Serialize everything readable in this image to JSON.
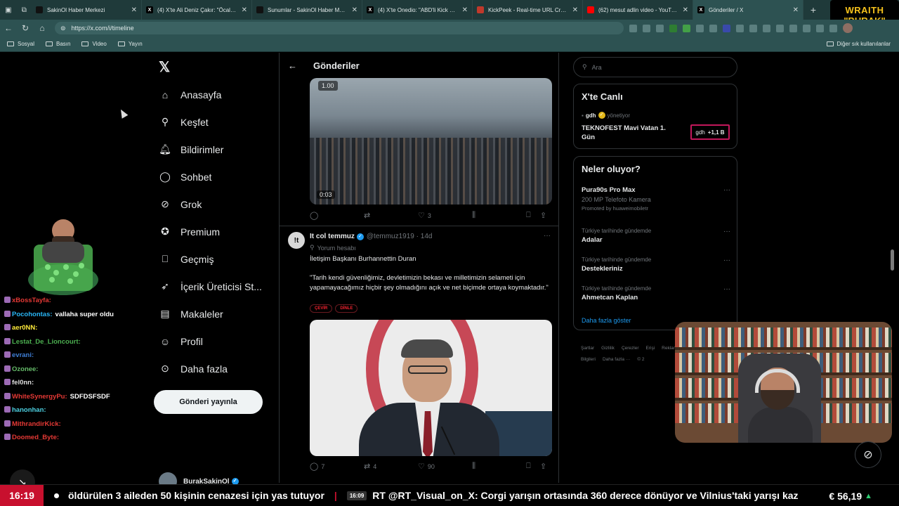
{
  "browser": {
    "tabs": [
      {
        "title": "SakinOl Haber Merkezi",
        "icon": "tiktok-icon",
        "color": "#111111"
      },
      {
        "title": "(4) X'te Ali Deniz Çakır: \"Öcalan, G",
        "icon": "x-icon",
        "color": "#000000"
      },
      {
        "title": "Sunumlar - SakinOl Haber Merkezi",
        "icon": "tiktok-icon",
        "color": "#111111"
      },
      {
        "title": "(4) X'te Onedio: \"ABD'li Kick yayı",
        "icon": "x-icon",
        "color": "#000000"
      },
      {
        "title": "KickPeek - Real-time URL Crawler",
        "icon": "kickpeek-icon",
        "color": "#c0392b"
      },
      {
        "title": "(62) mesut adlin video - YouTube",
        "icon": "youtube-icon",
        "color": "#ff0000"
      },
      {
        "title": "Gönderiler / X",
        "icon": "x-icon",
        "color": "#000000"
      }
    ],
    "url": "https://x.com/i/timeline",
    "bookmarks": [
      "Sosyal",
      "Basın",
      "Video",
      "Yayın"
    ],
    "bookmarks_right": "Diğer sık kullanılanlar"
  },
  "stream_logo": {
    "line1": "WRAITH",
    "line2": "\"BURAK\""
  },
  "nav": {
    "items": [
      {
        "label": "Anasayfa",
        "icon": "home-icon"
      },
      {
        "label": "Keşfet",
        "icon": "search-icon"
      },
      {
        "label": "Bildirimler",
        "icon": "bell-icon"
      },
      {
        "label": "Sohbet",
        "icon": "chat-icon"
      },
      {
        "label": "Grok",
        "icon": "grok-icon"
      },
      {
        "label": "Premium",
        "icon": "premium-icon"
      },
      {
        "label": "Geçmiş",
        "icon": "bookmark-icon"
      },
      {
        "label": "İçerik Üreticisi St...",
        "icon": "rocket-icon"
      },
      {
        "label": "Makaleler",
        "icon": "article-icon"
      },
      {
        "label": "Profil",
        "icon": "person-icon"
      },
      {
        "label": "Daha fazla",
        "icon": "more-icon"
      }
    ],
    "post_button": "Gönderi yayınla",
    "profile_name": "BurakSakinOl"
  },
  "timeline": {
    "title": "Gönderiler",
    "tweet1": {
      "video_speed": "1.00",
      "video_duration": "0:03",
      "likes": "3"
    },
    "tweet2": {
      "avatar_text": "!t",
      "name": "It col temmuz",
      "handle": "@temmuz1919 · 14d",
      "sub": "Yorum hesabı",
      "text": "İletişim Başkanı Burhannettin  Duran\n\n \"Tarih kendi güvenliğimiz, devletimizin bekası ve milletimizin selameti için yapamayacağımız hiçbir şey olmadığını açık ve net biçimde ortaya koymaktadır.\"",
      "chip1": "ÇEVİR",
      "chip2": "DİNLE",
      "replies": "7",
      "reposts": "4",
      "likes": "90"
    }
  },
  "sidebar": {
    "search_placeholder": "Ara",
    "live": {
      "title": "X'te Canlı",
      "host": "gdh",
      "host_suffix": "yönetiyor",
      "event": "TEKNOFEST Mavi Vatan 1. Gün",
      "count_host": "gdh",
      "count": "+1,1 B"
    },
    "trends": {
      "title": "Neler oluyor?",
      "items": [
        {
          "meta": "",
          "title": "Pura90s Pro Max",
          "sub": "200 MP Telefoto Kamera",
          "promo": "Promoted by huaweimobiletr"
        },
        {
          "meta": "Türkiye tarihinde gündemde",
          "title": "Adalar"
        },
        {
          "meta": "Türkiye tarihinde gündemde",
          "title": "Destekleriniz"
        },
        {
          "meta": "Türkiye tarihinde gündemde",
          "title": "Ahmetcan Kaplan"
        }
      ],
      "show_more": "Daha fazla göster"
    },
    "footer": [
      "Şartlar",
      "Gizlilik",
      "Çerezler",
      "Erişi",
      "Reklam Bilgileri",
      "Daha fazla ···",
      "© 2"
    ]
  },
  "chat": [
    {
      "user": "xBossTayfa:",
      "color": "#e53935",
      "msg": ""
    },
    {
      "user": "Pocohontas:",
      "color": "#29b6f6",
      "msg": "vallaha super oldu"
    },
    {
      "user": "aer0NN:",
      "color": "#ffeb3b",
      "msg": ""
    },
    {
      "user": "Lestat_De_Lioncourt:",
      "color": "#4caf50",
      "msg": ""
    },
    {
      "user": "evrani:",
      "color": "#3f7fd6",
      "msg": ""
    },
    {
      "user": "Ozonee:",
      "color": "#66bb6a",
      "msg": ""
    },
    {
      "user": "fel0nn:",
      "color": "#e0e0e0",
      "msg": ""
    },
    {
      "user": "WhiteSynergyPu:",
      "color": "#e53935",
      "msg": "SDFDSFSDF"
    },
    {
      "user": "hanonhan:",
      "color": "#4dd0e1",
      "msg": ""
    },
    {
      "user": "MithrandirKick:",
      "color": "#e53935",
      "msg": ""
    },
    {
      "user": "Doomed_Byte:",
      "color": "#e53935",
      "msg": ""
    }
  ],
  "ticker": {
    "time": "16:19",
    "headline1": "öldürülen 3 aileden 50 kişinin cenazesi için yas tutuyor",
    "small_time": "16:09",
    "headline2": "RT @RT_Visual_on_X: Corgi yarışın ortasında 360 derece dönüyor ve Vilnius'taki yarışı kaz",
    "price": "€ 56,19"
  }
}
